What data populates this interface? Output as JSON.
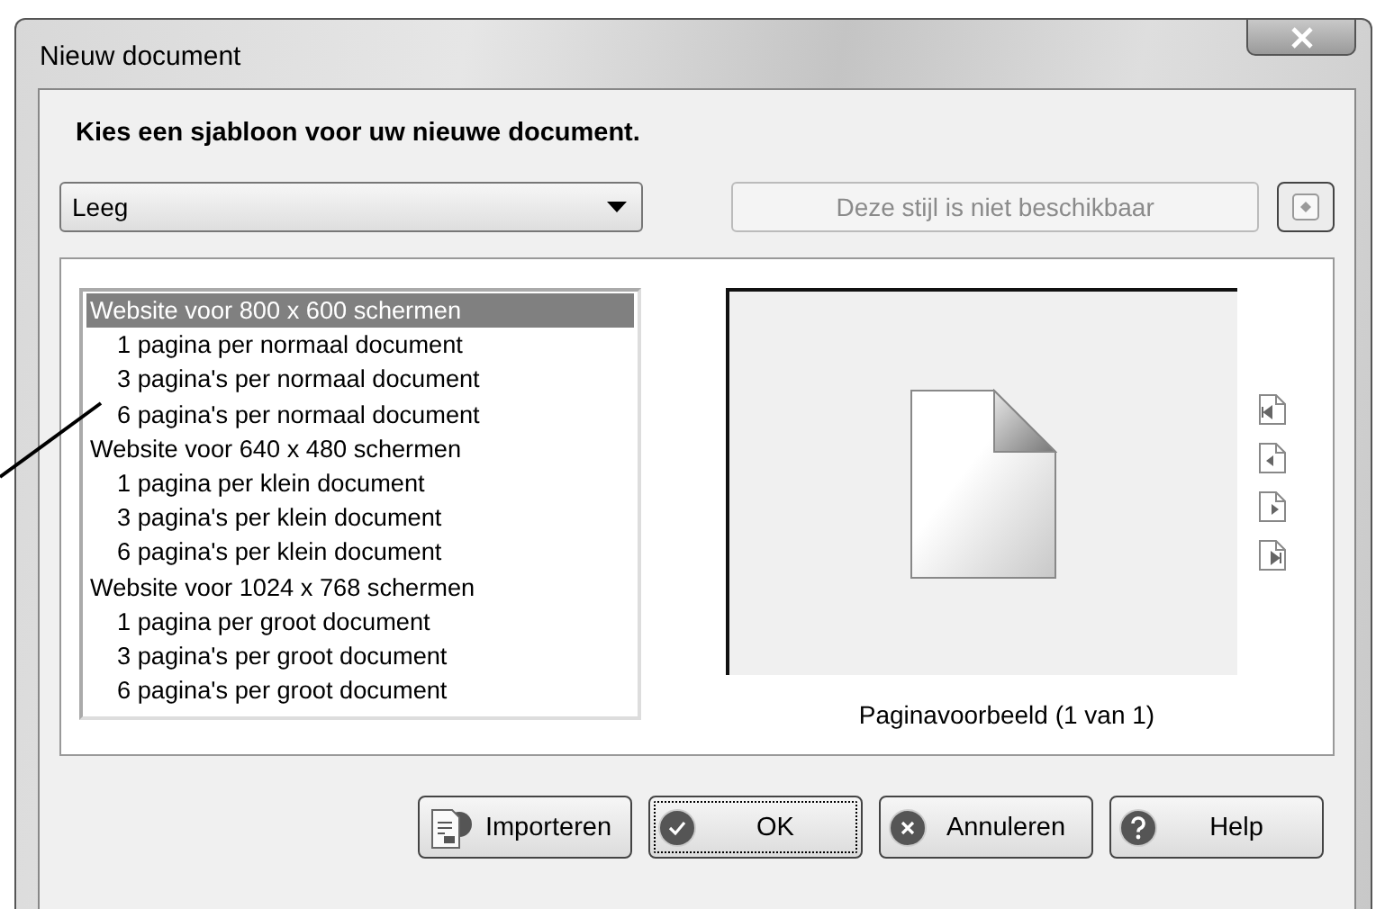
{
  "window": {
    "title": "Nieuw document"
  },
  "heading": "Kies een sjabloon voor uw nieuwe document.",
  "style_dropdown": {
    "value": "Leeg"
  },
  "style_button": {
    "label": "Deze stijl is niet beschikbaar",
    "disabled": true
  },
  "templates": [
    {
      "label": "Website voor 800 x 600 schermen",
      "selected": true,
      "children": [
        {
          "label": "1 pagina per normaal document",
          "selected": false
        },
        {
          "label": "3 pagina's per normaal document",
          "selected": false
        },
        {
          "label": "6 pagina's per normaal document",
          "selected": false
        }
      ]
    },
    {
      "label": "Website voor 640 x 480 schermen",
      "selected": false,
      "children": [
        {
          "label": "1 pagina per klein document",
          "selected": false
        },
        {
          "label": "3 pagina's per klein document",
          "selected": false
        },
        {
          "label": "6 pagina's per klein document",
          "selected": false
        }
      ]
    },
    {
      "label": "Website voor 1024 x 768 schermen",
      "selected": false,
      "children": [
        {
          "label": "1 pagina per groot document",
          "selected": false
        },
        {
          "label": "3 pagina's per groot document",
          "selected": false
        },
        {
          "label": "6 pagina's per groot document",
          "selected": false
        }
      ]
    }
  ],
  "preview": {
    "caption": "Paginavoorbeeld (1 van 1)"
  },
  "buttons": [
    {
      "label": "Importeren",
      "kind": "import",
      "default": false
    },
    {
      "label": "OK",
      "kind": "ok",
      "default": true
    },
    {
      "label": "Annuleren",
      "kind": "cancel",
      "default": false
    },
    {
      "label": "Help",
      "kind": "help",
      "default": false
    }
  ]
}
